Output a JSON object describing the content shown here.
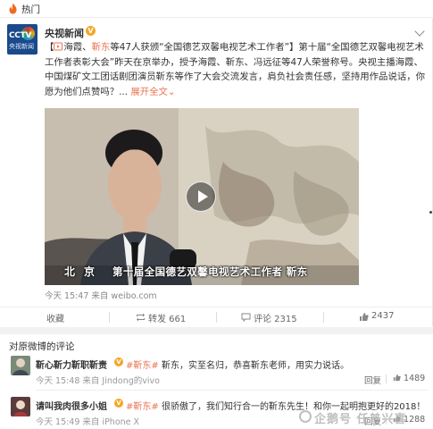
{
  "topbar": {
    "label": "热门"
  },
  "post": {
    "author": "央视新闻",
    "verified_mark": "V",
    "avatar_text": {
      "brand": "CCTV",
      "sub": "央视新闻"
    },
    "text_parts": {
      "p1": "【",
      "p2": "海霞、",
      "p3": "靳东",
      "p4": "等47人获颁“全国德艺双馨电视艺术工作者”】第十届“全国德艺双馨电视艺术工作者表彰大会”昨天在京举办，授予海霞、靳东、冯远征等47人荣誉称号。央视主播海霞、中国煤矿文工团话剧团演员靳东等作了大会交流发言，肩负社会责任感，坚持用作品说话，你愿为他们点赞吗？...",
      "more": "展开全文⌄"
    },
    "video_caption": {
      "city": "北京",
      "subtitle": "第十届全国德艺双馨电视艺术工作者 靳东"
    },
    "meta": "今天 15:47 来自 weibo.com",
    "actions": {
      "collect": "收藏",
      "repost": "转发 661",
      "comment": "评论 2315",
      "like": "2437"
    }
  },
  "comments_section": {
    "title": "对原微博的评论",
    "comments": [
      {
        "name": "靳心靳力靳职靳责",
        "badge": "V",
        "tag": "#靳东#",
        "text": " 靳东，实至名归，恭喜靳东老师，用实力说话。",
        "meta": "今天 15:48 来自 Jindong的vivo",
        "reply": "回复",
        "likes": "1489"
      },
      {
        "name": "请叫我肉很多小姐",
        "badge": "V",
        "tag": "#靳东#",
        "text": " 很骄傲了，我们知行合一的靳东先生！和你一起明抱更好的2018！",
        "meta": "今天 15:49 来自 iPhone X",
        "reply": "回复",
        "likes": "1288"
      }
    ]
  },
  "watermark": "企鹅号 任普兴喜",
  "colors": {
    "accent": "#eb7350",
    "verified": "#f5a623"
  }
}
